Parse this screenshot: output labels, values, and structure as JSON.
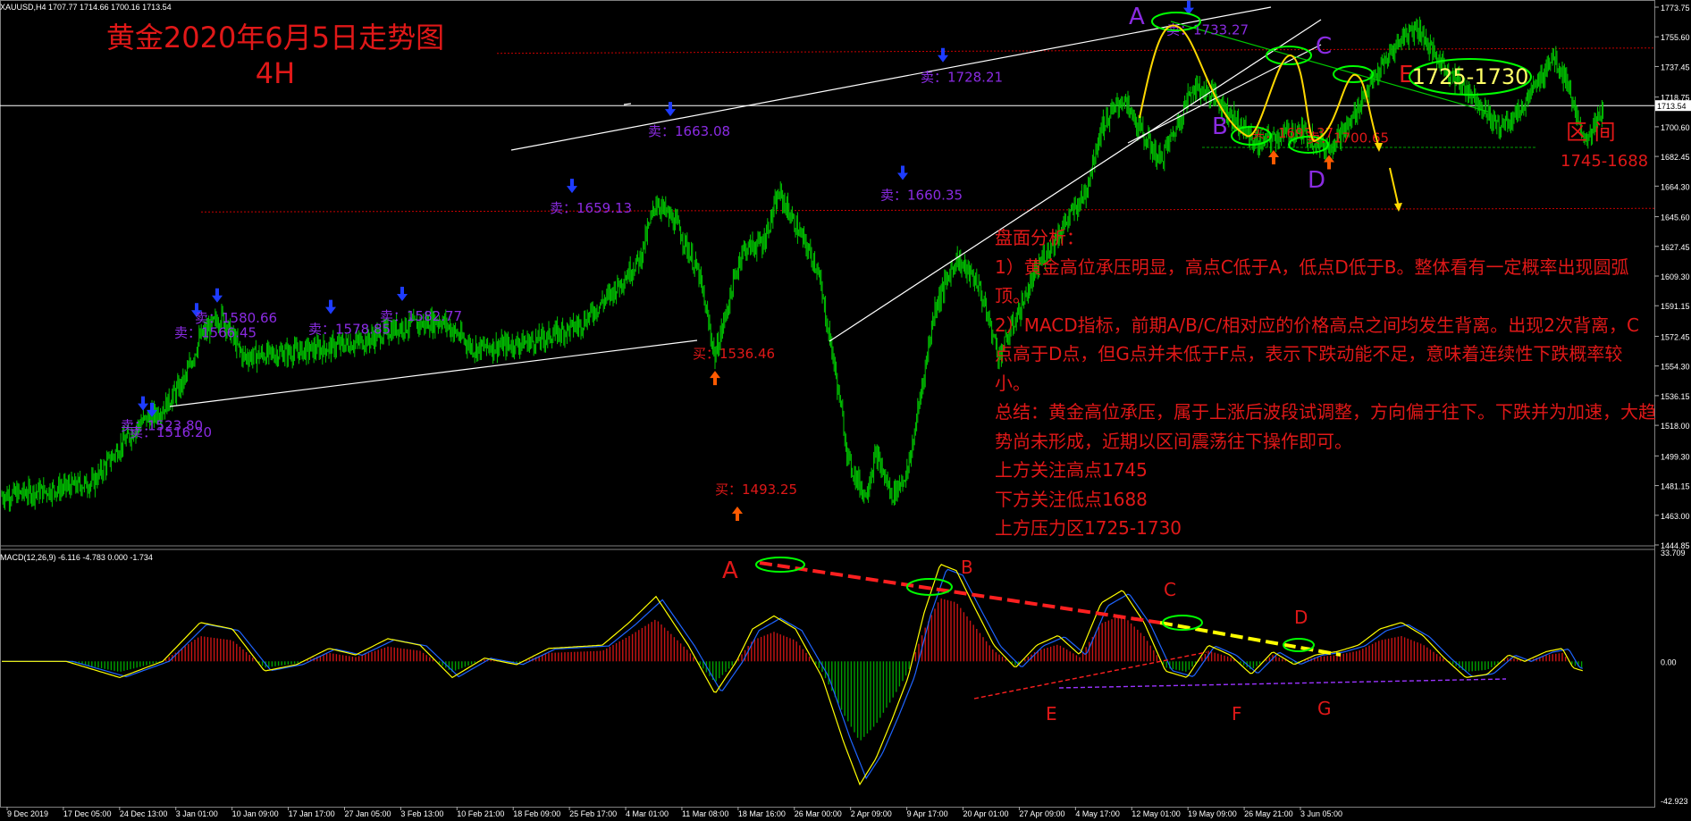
{
  "header": {
    "symbol_info": "XAUUSD,H4  1707.77 1714.66 1700.16 1713.54",
    "macd_info": "MACD(12,26,9) -6.116 -4.783 0.000 -1.734"
  },
  "headline": {
    "line1": "黄金2020年6月5日走势图",
    "line2": "4H"
  },
  "analysis": {
    "title": "盘面分析：",
    "lines": [
      "1）黄金高位承压明显，高点C低于A，低点D低于B。整体看有一定概率出现圆弧顶。",
      "2）MACD指标，前期A/B/C/相对应的价格高点之间均发生背离。出现2次背离，C点高于D点，但G点并未低于F点，表示下跌动能不足，意味着连续性下跌概率较小。",
      "总结：黄金高位承压，属于上涨后波段试调整，方向偏于往下。下跌并为加速，大趋势尚未形成，近期以区间震荡往下操作即可。",
      "上方关注高点1745",
      "下方关注低点1688",
      "上方压力区1725-1730"
    ]
  },
  "range_note": {
    "label": "区 间",
    "value": "1745-1688"
  },
  "pressure_box": "1725-1730",
  "colors": {
    "candle": "#00c800",
    "annotation_red": "#e01818",
    "annotation_purple": "#8a2be2",
    "ellipse": "#00ff00",
    "arrow_yellow": "#ffd800",
    "macd_line": "#ffff00",
    "signal_line": "#1e64ff",
    "hist_pos": "#c81414",
    "hist_neg": "#00a000"
  },
  "chart_data": [
    {
      "type": "line",
      "title": "XAUUSD,H4",
      "ylim": [
        1444.85,
        1773.75
      ],
      "y_ticks": [
        "1773.75",
        "1755.60",
        "1737.45",
        "1718.75",
        "1713.54",
        "1700.60",
        "1682.45",
        "1664.30",
        "1645.60",
        "1627.45",
        "1609.30",
        "1591.15",
        "1572.45",
        "1554.30",
        "1536.15",
        "1518.00",
        "1499.30",
        "1481.15",
        "1463.00",
        "1444.85"
      ],
      "x_ticks": [
        "9 Dec 2019",
        "17 Dec 05:00",
        "24 Dec 13:00",
        "3 Jan 01:00",
        "10 Jan 09:00",
        "17 Jan 17:00",
        "27 Jan 05:00",
        "3 Feb 13:00",
        "10 Feb 21:00",
        "18 Feb 09:00",
        "25 Feb 17:00",
        "4 Mar 01:00",
        "11 Mar 08:00",
        "18 Mar 16:00",
        "26 Mar 00:00",
        "2 Apr 09:00",
        "9 Apr 17:00",
        "20 Apr 01:00",
        "27 Apr 09:00",
        "4 May 17:00",
        "12 May 01:00",
        "19 May 09:00",
        "26 May 21:00",
        "3 Jun 05:00"
      ],
      "path": [
        [
          0,
          1475
        ],
        [
          40,
          1478
        ],
        [
          85,
          1483
        ],
        [
          110,
          1505
        ],
        [
          130,
          1520
        ],
        [
          150,
          1528
        ],
        [
          170,
          1545
        ],
        [
          185,
          1572
        ],
        [
          205,
          1585
        ],
        [
          225,
          1560
        ],
        [
          260,
          1562
        ],
        [
          300,
          1565
        ],
        [
          340,
          1570
        ],
        [
          370,
          1578
        ],
        [
          410,
          1582
        ],
        [
          440,
          1565
        ],
        [
          470,
          1567
        ],
        [
          500,
          1570
        ],
        [
          540,
          1580
        ],
        [
          570,
          1600
        ],
        [
          595,
          1620
        ],
        [
          610,
          1655
        ],
        [
          630,
          1640
        ],
        [
          650,
          1610
        ],
        [
          665,
          1560
        ],
        [
          690,
          1625
        ],
        [
          710,
          1630
        ],
        [
          725,
          1660
        ],
        [
          740,
          1640
        ],
        [
          760,
          1615
        ],
        [
          775,
          1560
        ],
        [
          790,
          1495
        ],
        [
          805,
          1475
        ],
        [
          815,
          1500
        ],
        [
          830,
          1475
        ],
        [
          845,
          1490
        ],
        [
          855,
          1530
        ],
        [
          870,
          1590
        ],
        [
          890,
          1620
        ],
        [
          910,
          1605
        ],
        [
          930,
          1560
        ],
        [
          950,
          1590
        ],
        [
          970,
          1620
        ],
        [
          990,
          1640
        ],
        [
          1010,
          1660
        ],
        [
          1025,
          1700
        ],
        [
          1045,
          1718
        ],
        [
          1060,
          1700
        ],
        [
          1080,
          1680
        ],
        [
          1095,
          1700
        ],
        [
          1110,
          1725
        ],
        [
          1130,
          1720
        ],
        [
          1150,
          1705
        ],
        [
          1170,
          1690
        ],
        [
          1190,
          1695
        ],
        [
          1210,
          1698
        ],
        [
          1235,
          1688
        ],
        [
          1255,
          1700
        ],
        [
          1270,
          1720
        ],
        [
          1290,
          1740
        ],
        [
          1305,
          1755
        ],
        [
          1320,
          1762
        ],
        [
          1335,
          1745
        ],
        [
          1355,
          1730
        ],
        [
          1375,
          1718
        ],
        [
          1395,
          1700
        ],
        [
          1415,
          1710
        ],
        [
          1435,
          1730
        ],
        [
          1445,
          1745
        ],
        [
          1460,
          1728
        ],
        [
          1470,
          1700
        ],
        [
          1480,
          1693
        ],
        [
          1493,
          1712
        ]
      ],
      "horizontal_levels": [
        1745.5,
        1713.54,
        1688,
        1648.5
      ],
      "trade_labels": [
        {
          "text": "卖：1523.80",
          "price": 1515,
          "kind": "sell"
        },
        {
          "text": "卖：1516.20",
          "price": 1511,
          "kind": "sell"
        },
        {
          "text": "卖：1566.45",
          "price": 1572,
          "kind": "sell"
        },
        {
          "text": "卖：1580.66",
          "price": 1581,
          "kind": "sell"
        },
        {
          "text": "卖：1578.85",
          "price": 1574,
          "kind": "sell"
        },
        {
          "text": "卖：1582.77",
          "price": 1582,
          "kind": "sell"
        },
        {
          "text": "卖：1659.13",
          "price": 1648,
          "kind": "sell"
        },
        {
          "text": "卖：1663.08",
          "price": 1695,
          "kind": "sell"
        },
        {
          "text": "买：1536.46",
          "price": 1559,
          "kind": "buy"
        },
        {
          "text": "买：1493.25",
          "price": 1476,
          "kind": "buy"
        },
        {
          "text": "卖：1660.35",
          "price": 1656,
          "kind": "sell"
        },
        {
          "text": "卖：1728.21",
          "price": 1728,
          "kind": "sell"
        },
        {
          "text": "卖：1733.27",
          "price": 1757,
          "kind": "sell"
        },
        {
          "text": "买：1693.37",
          "price": 1694,
          "kind": "buy"
        },
        {
          "text": "卖：1700.65",
          "price": 1691,
          "kind": "buy"
        }
      ],
      "point_labels": [
        "A",
        "B",
        "C",
        "D",
        "E"
      ]
    },
    {
      "type": "bar",
      "title": "MACD(12,26,9) -6.116 -4.783 0.000 -1.734",
      "ylim": [
        -42.923,
        33.709
      ],
      "y_ticks": [
        "33.709",
        "0.00",
        "-42.923"
      ],
      "macd_path": [
        [
          0,
          0
        ],
        [
          60,
          0
        ],
        [
          110,
          -5
        ],
        [
          150,
          0
        ],
        [
          185,
          12
        ],
        [
          215,
          10
        ],
        [
          245,
          -3
        ],
        [
          275,
          -1
        ],
        [
          305,
          4
        ],
        [
          330,
          2
        ],
        [
          360,
          7
        ],
        [
          390,
          5
        ],
        [
          420,
          -5
        ],
        [
          450,
          1
        ],
        [
          480,
          -1
        ],
        [
          510,
          4
        ],
        [
          560,
          5
        ],
        [
          585,
          12
        ],
        [
          610,
          20
        ],
        [
          640,
          5
        ],
        [
          665,
          -10
        ],
        [
          685,
          0
        ],
        [
          700,
          10
        ],
        [
          720,
          14
        ],
        [
          740,
          10
        ],
        [
          765,
          -5
        ],
        [
          785,
          -25
        ],
        [
          800,
          -38
        ],
        [
          815,
          -30
        ],
        [
          830,
          -18
        ],
        [
          845,
          -5
        ],
        [
          860,
          15
        ],
        [
          875,
          30
        ],
        [
          890,
          28
        ],
        [
          905,
          18
        ],
        [
          925,
          5
        ],
        [
          945,
          -2
        ],
        [
          965,
          5
        ],
        [
          985,
          8
        ],
        [
          1005,
          2
        ],
        [
          1025,
          18
        ],
        [
          1045,
          22
        ],
        [
          1065,
          12
        ],
        [
          1085,
          -3
        ],
        [
          1105,
          -5
        ],
        [
          1125,
          5
        ],
        [
          1145,
          2
        ],
        [
          1165,
          -4
        ],
        [
          1185,
          3
        ],
        [
          1205,
          -1
        ],
        [
          1225,
          2
        ],
        [
          1245,
          3
        ],
        [
          1265,
          5
        ],
        [
          1285,
          10
        ],
        [
          1305,
          12
        ],
        [
          1325,
          8
        ],
        [
          1345,
          1
        ],
        [
          1365,
          -5
        ],
        [
          1385,
          -4
        ],
        [
          1405,
          2
        ],
        [
          1420,
          0
        ],
        [
          1440,
          3
        ],
        [
          1455,
          4
        ],
        [
          1465,
          -2
        ],
        [
          1475,
          -3
        ]
      ],
      "divergence_labels": [
        "A",
        "B",
        "C",
        "D",
        "E",
        "F",
        "G"
      ]
    }
  ]
}
